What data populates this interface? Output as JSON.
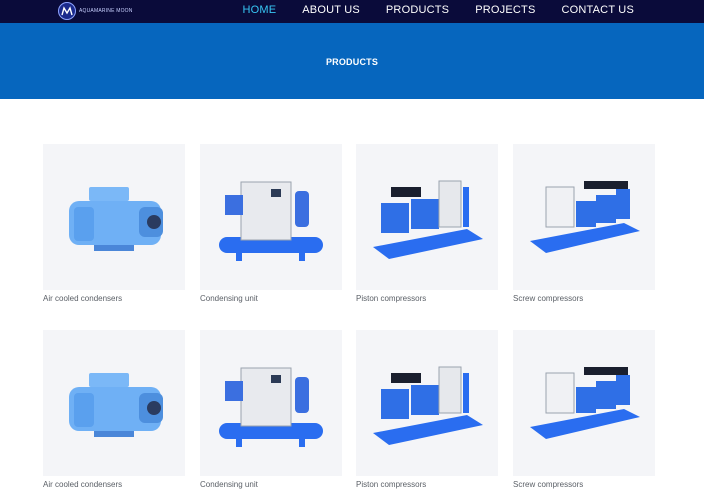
{
  "header": {
    "logo_text": "AQUAMARINE MOON",
    "nav": [
      {
        "label": "HOME",
        "active": true
      },
      {
        "label": "ABOUT US",
        "active": false
      },
      {
        "label": "PRODUCTS",
        "active": false
      },
      {
        "label": "PROJECTS",
        "active": false
      },
      {
        "label": "CONTACT US",
        "active": false
      }
    ]
  },
  "banner": {
    "title": "PRODUCTS"
  },
  "products": [
    {
      "name": "Air cooled condensers",
      "icon": "compressor-image"
    },
    {
      "name": "Condensing unit",
      "icon": "condensing-unit-image"
    },
    {
      "name": "Piston compressors",
      "icon": "piston-rack-image"
    },
    {
      "name": "Screw compressors",
      "icon": "screw-rack-image"
    },
    {
      "name": "Air cooled condensers",
      "icon": "compressor-image"
    },
    {
      "name": "Condensing unit",
      "icon": "condensing-unit-image"
    },
    {
      "name": "Piston compressors",
      "icon": "piston-rack-image"
    },
    {
      "name": "Screw compressors",
      "icon": "screw-rack-image"
    }
  ],
  "colors": {
    "topbar": "#0a0b3a",
    "banner": "#0666be",
    "nav_active": "#37c6f4",
    "equipment_blue": "#2a6df0",
    "compressor_blue": "#6fb0f5"
  }
}
